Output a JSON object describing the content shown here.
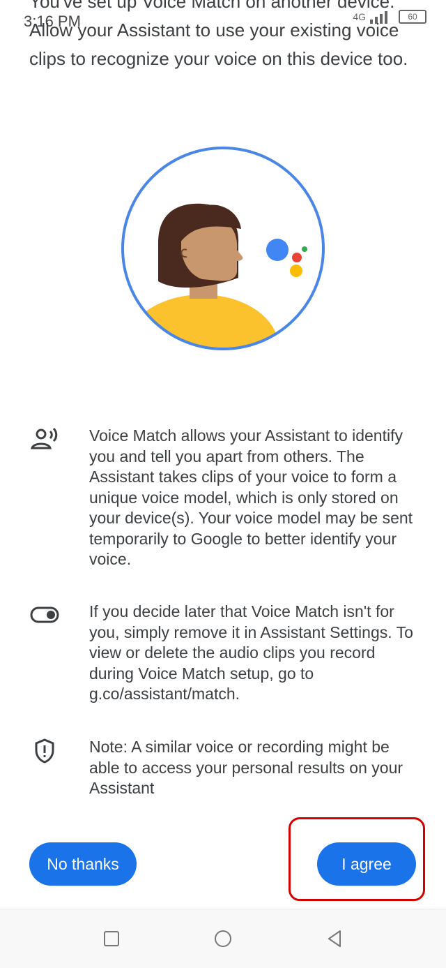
{
  "status_bar": {
    "time": "3:16 PM",
    "network": "4G",
    "battery": "60"
  },
  "intro_text": "You've set up Voice Match on another device. Allow your Assistant to use your existing voice clips to recognize your voice on this device too.",
  "illustration": {
    "name": "voice-match-illustration",
    "assistant_colors": [
      "#4285f4",
      "#ea4335",
      "#fbbc05",
      "#34a853"
    ],
    "skin_color": "#c9976d",
    "hair_color": "#4a2a1f",
    "shirt_color": "#fbc22d",
    "ring_color": "#4a86e8"
  },
  "info_items": [
    {
      "icon": "voice-person-icon",
      "text": "Voice Match allows your Assistant to identify you and tell you apart from others. The Assistant takes clips of your voice to form a unique voice model, which is only stored on your device(s). Your voice model may be sent temporarily to Google to better identify your voice."
    },
    {
      "icon": "toggle-icon",
      "text": "If you decide later that Voice Match isn't for you, simply remove it in Assistant Settings. To view or delete the audio clips you record during Voice Match setup, go to g.co/assistant/match."
    },
    {
      "icon": "shield-alert-icon",
      "text": "Note: A similar voice or recording might be able to access your personal results on your Assistant"
    }
  ],
  "buttons": {
    "decline": "No thanks",
    "agree": "I agree"
  },
  "colors": {
    "accent": "#1a73e8",
    "highlight": "#d40000"
  }
}
